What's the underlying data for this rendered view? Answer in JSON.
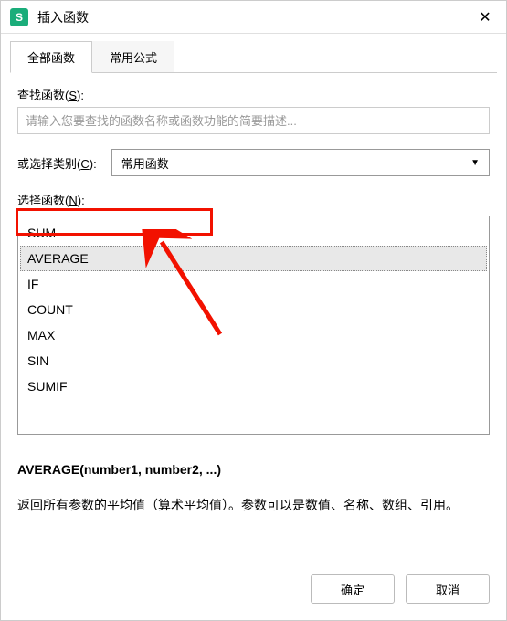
{
  "titlebar": {
    "icon_letter": "S",
    "title": "插入函数",
    "close_glyph": "✕"
  },
  "tabs": {
    "all_functions": "全部函数",
    "common_formulas": "常用公式"
  },
  "search": {
    "label_pre": "查找函数(",
    "label_u": "S",
    "label_post": "):",
    "placeholder": "请输入您要查找的函数名称或函数功能的简要描述..."
  },
  "category": {
    "label_pre": "或选择类别(",
    "label_u": "C",
    "label_post": "):",
    "selected": "常用函数",
    "chevron": "▼"
  },
  "select_func": {
    "label_pre": "选择函数(",
    "label_u": "N",
    "label_post": "):"
  },
  "functions": [
    "SUM",
    "AVERAGE",
    "IF",
    "COUNT",
    "MAX",
    "SIN",
    "SUMIF"
  ],
  "selected_index": 1,
  "description": {
    "signature": "AVERAGE(number1, number2, ...)",
    "text": "返回所有参数的平均值（算术平均值）。参数可以是数值、名称、数组、引用。"
  },
  "footer": {
    "ok": "确定",
    "cancel": "取消"
  }
}
